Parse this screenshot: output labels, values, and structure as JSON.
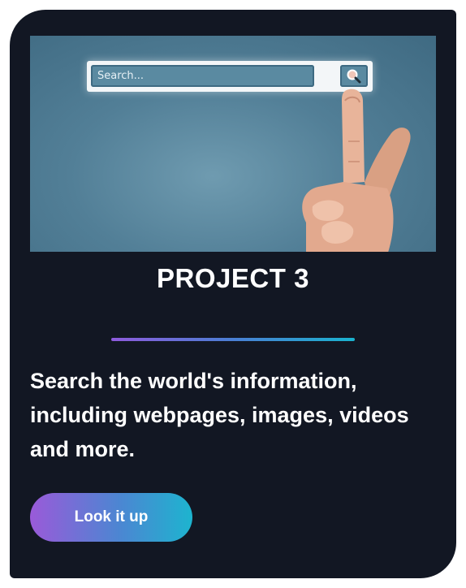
{
  "card": {
    "image": {
      "search_placeholder": "Search...",
      "search_icon": "magnifier-icon"
    },
    "title": "PROJECT 3",
    "description": "Search the world's information, including webpages, images, videos and more.",
    "button_label": "Look it up"
  },
  "colors": {
    "card_background": "#121723",
    "accent_start": "#9a5ad9",
    "accent_end": "#1db4cf",
    "text": "#ffffff"
  }
}
